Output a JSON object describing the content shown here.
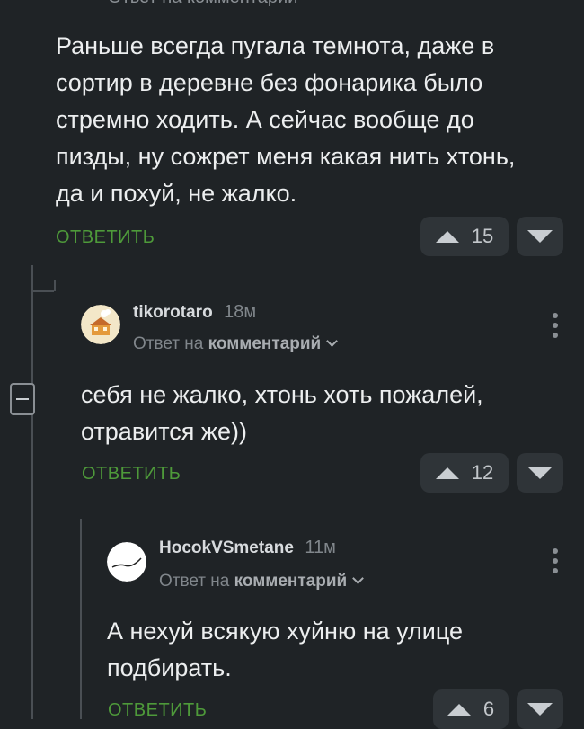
{
  "top_header_cutoff": "Ответ на комментарий",
  "comment1": {
    "text": "Раньше всегда пугала темнота, даже в\nсортир в деревне без фонарика было\nстремно ходить. А сейчас вообще до\nпизды, ну сожрет меня какая нить хтонь,\nда и похуй, не жалко.",
    "reply_label": "ОТВЕТИТЬ",
    "score": "15"
  },
  "comment2": {
    "username": "tikorotaro",
    "time": "18м",
    "reply_prefix": "Ответ на",
    "reply_target": "комментарий",
    "text": "себя не жалко, хтонь хоть пожалей,\nотравится же))",
    "reply_label": "ОТВЕТИТЬ",
    "score": "12"
  },
  "comment3": {
    "username": "HocokVSmetane",
    "time": "11м",
    "reply_prefix": "Ответ на",
    "reply_target": "комментарий",
    "text": "А нехуй всякую хуйню на улице\nподбирать.",
    "reply_label": "ОТВЕТИТЬ",
    "score": "6"
  },
  "colors": {
    "background": "#1f2326",
    "accent_green": "#4e9a3a",
    "button_bg": "#2f3438"
  },
  "icons": [
    "upvote-icon",
    "downvote-icon",
    "collapse-icon",
    "more-options-icon",
    "chevron-down-icon"
  ]
}
